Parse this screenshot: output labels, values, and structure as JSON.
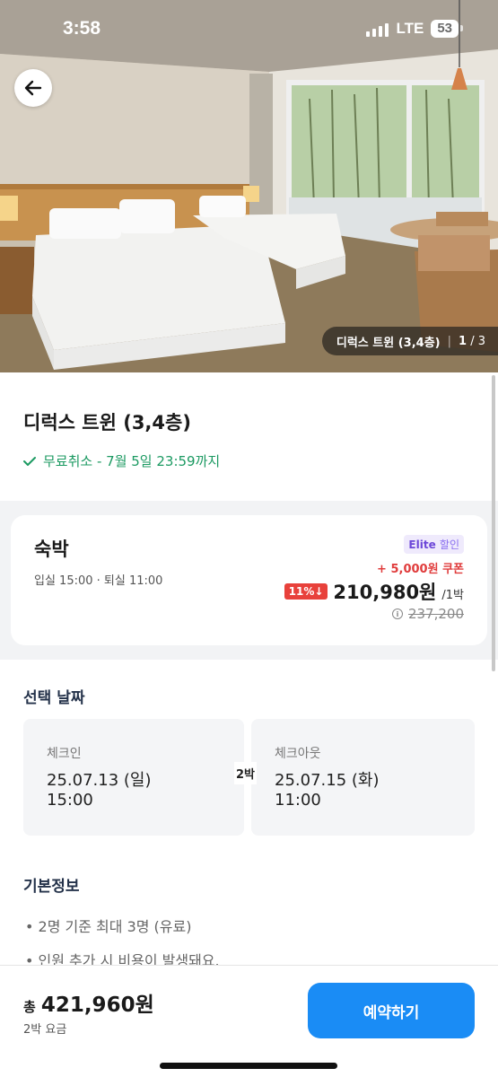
{
  "status_bar": {
    "time": "3:58",
    "network": "LTE",
    "battery": "53"
  },
  "hero": {
    "caption_title": "디럭스 트윈 (3,4층)",
    "caption_current": "1",
    "caption_total": "3"
  },
  "room": {
    "title": "디럭스 트윈 (3,4층)",
    "free_cancel": "무료취소 - 7월 5일 23:59까지"
  },
  "plan": {
    "name": "숙박",
    "checkin_checkout": "입실 15:00 · 퇴실 11:00",
    "elite_label": "Elite",
    "elite_suffix": "할인",
    "coupon": "+ 5,000원 쿠폰",
    "discount": "11%↓",
    "price": "210,980원",
    "price_unit": "/1박",
    "original_price": "237,200"
  },
  "dates": {
    "title": "선택 날짜",
    "checkin_label": "체크인",
    "checkin_date": "25.07.13 (일)",
    "checkin_time": "15:00",
    "nights": "2박",
    "checkout_label": "체크아웃",
    "checkout_date": "25.07.15 (화)",
    "checkout_time": "11:00"
  },
  "basic_info": {
    "title": "기본정보",
    "items": [
      "2명 기준 최대 3명 (유료)",
      "인원 추가 시 비용이 발생돼요."
    ]
  },
  "bottom": {
    "total_prefix": "총",
    "total_price": "421,960원",
    "total_sub": "2박 요금",
    "book_label": "예약하기"
  },
  "colors": {
    "accent": "#1a8cf5",
    "success": "#1c9a62",
    "sale": "#e8413b",
    "elite": "#6d48d8"
  },
  "icons": [
    "back-arrow-icon",
    "check-icon",
    "info-icon",
    "signal-icon",
    "battery-icon"
  ]
}
